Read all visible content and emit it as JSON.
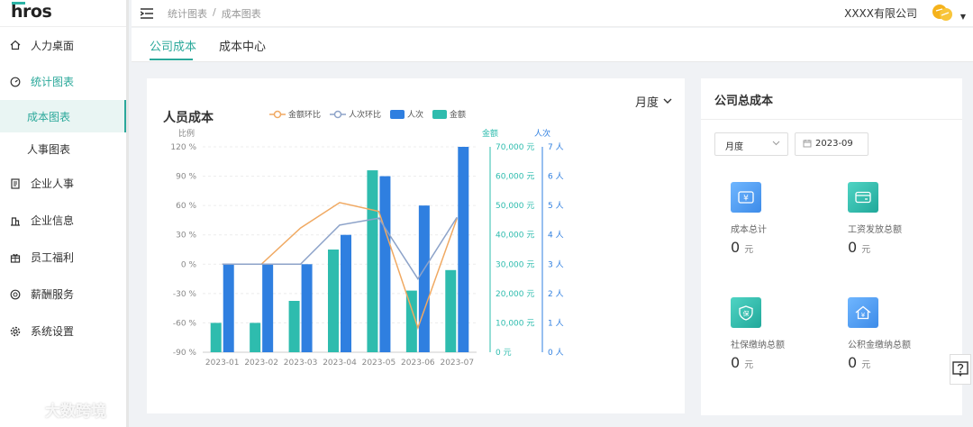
{
  "app": {
    "logo": "hros"
  },
  "sidebar": {
    "items": [
      {
        "label": "人力桌面",
        "icon": "home-icon"
      },
      {
        "label": "统计图表",
        "icon": "dashboard-icon"
      },
      {
        "label": "企业人事",
        "icon": "document-icon"
      },
      {
        "label": "企业信息",
        "icon": "building-icon"
      },
      {
        "label": "员工福利",
        "icon": "gift-icon"
      },
      {
        "label": "薪酬服务",
        "icon": "money-icon"
      },
      {
        "label": "系统设置",
        "icon": "gear-icon"
      }
    ],
    "sub_items": [
      {
        "label": "成本图表"
      },
      {
        "label": "人事图表"
      }
    ]
  },
  "header": {
    "breadcrumb": [
      "统计图表",
      "/",
      "成本图表"
    ],
    "company": "XXXX有限公司"
  },
  "tabs": [
    {
      "label": "公司成本"
    },
    {
      "label": "成本中心"
    }
  ],
  "chart_panel": {
    "title": "人员成本",
    "period": "月度"
  },
  "chart_data": {
    "type": "bar",
    "title": "人员成本",
    "categories": [
      "2023-01",
      "2023-02",
      "2023-03",
      "2023-04",
      "2023-05",
      "2023-06",
      "2023-07"
    ],
    "series": [
      {
        "name": "金额",
        "kind": "bar",
        "axis": "amount",
        "color": "#2ebcae",
        "values": [
          10000,
          10000,
          17500,
          35000,
          62000,
          21000,
          28000
        ]
      },
      {
        "name": "人次",
        "kind": "bar",
        "axis": "count",
        "color": "#2f7fe0",
        "values": [
          3,
          3,
          3,
          4,
          6,
          5,
          7
        ]
      },
      {
        "name": "金额环比",
        "kind": "line",
        "axis": "ratio",
        "color": "#f0a962",
        "values": [
          0,
          0,
          37,
          63,
          54,
          -65,
          47
        ]
      },
      {
        "name": "人次环比",
        "kind": "line",
        "axis": "ratio",
        "color": "#8da3c9",
        "values": [
          0,
          0,
          0,
          40,
          47,
          -15,
          48
        ]
      }
    ],
    "axes": {
      "ratio": {
        "label": "比例",
        "min": -90,
        "max": 120,
        "step": 30,
        "ticks": [
          "120 %",
          "90 %",
          "60 %",
          "30 %",
          "0 %",
          "-30 %",
          "-60 %",
          "-90 %"
        ]
      },
      "amount": {
        "label": "金额",
        "min": 0,
        "max": 70000,
        "ticks": [
          "70,000 元",
          "60,000 元",
          "50,000 元",
          "40,000 元",
          "30,000 元",
          "20,000 元",
          "10,000 元",
          "0 元"
        ]
      },
      "count": {
        "label": "人次",
        "min": 0,
        "max": 7,
        "ticks": [
          "7 人",
          "6 人",
          "5 人",
          "4 人",
          "3 人",
          "2 人",
          "1 人",
          "0 人"
        ]
      }
    },
    "legend_order": [
      "金额环比",
      "人次环比",
      "人次",
      "金额"
    ],
    "grid": true,
    "legend_position": "top"
  },
  "summary": {
    "title": "公司总成本",
    "filter": "月度",
    "date": "2023-09",
    "stats": [
      {
        "label": "成本总计",
        "value": "0",
        "unit": "元",
        "icon": "cost-icon",
        "color": "#4a9ef5"
      },
      {
        "label": "工资发放总额",
        "value": "0",
        "unit": "元",
        "icon": "salary-card-icon",
        "color": "#2ebcae"
      },
      {
        "label": "社保缴纳总额",
        "value": "0",
        "unit": "元",
        "icon": "social-insurance-icon",
        "color": "#2ebcae"
      },
      {
        "label": "公积金缴纳总额",
        "value": "0",
        "unit": "元",
        "icon": "housing-fund-icon",
        "color": "#4a9ef5"
      }
    ]
  },
  "watermark": "大数跨境"
}
